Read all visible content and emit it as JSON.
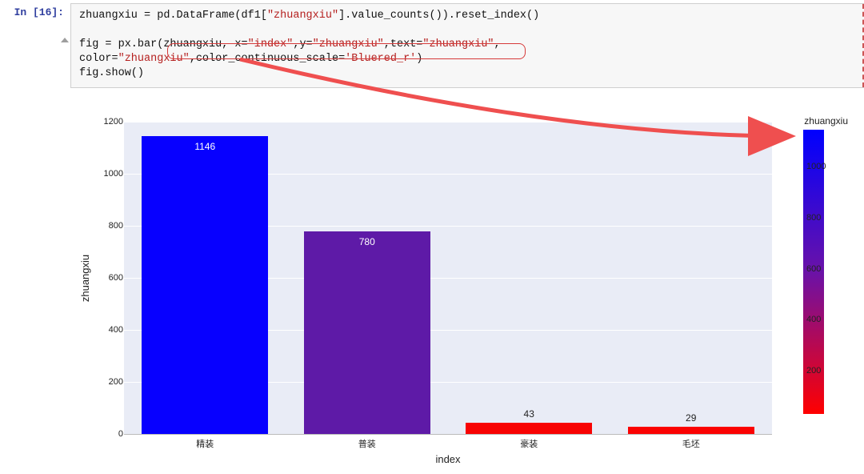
{
  "cell": {
    "prompt": "In [16]:",
    "lines": {
      "l1a": "zhuangxiu = pd.DataFrame(df1[",
      "l1b": "\"zhuangxiu\"",
      "l1c": "].value_counts()).reset_index()",
      "l2a": "fig = px.bar(zhuangxiu, x=",
      "l2b": "\"index\"",
      "l2c": ",y=",
      "l2d": "\"zhuangxiu\"",
      "l2e": ",text=",
      "l2f": "\"zhuangxiu\"",
      "l2g": ",",
      "l3a": "             color=",
      "l3b": "\"zhuangxiu\"",
      "l3c": ",color_continuous_scale=",
      "l3d": "'Bluered_r'",
      "l3e": ")",
      "l4": "fig.show()"
    }
  },
  "chart_data": {
    "type": "bar",
    "categories": [
      "精装",
      "普装",
      "豪装",
      "毛坯"
    ],
    "values": [
      1146,
      780,
      43,
      29
    ],
    "text": [
      "1146",
      "780",
      "43",
      "29"
    ],
    "colors": [
      "#0700ff",
      "#5e1aa7",
      "#f80303",
      "#fb0202"
    ],
    "color_scale": "Bluered_r",
    "xlabel": "index",
    "ylabel": "zhuangxiu",
    "ylim": [
      0,
      1200
    ],
    "yticks": [
      0,
      200,
      400,
      600,
      800,
      1000,
      1200
    ],
    "colorbar": {
      "title": "zhuangxiu",
      "ticks": [
        200,
        400,
        600,
        800,
        1000
      ],
      "range": [
        29,
        1146
      ]
    }
  }
}
